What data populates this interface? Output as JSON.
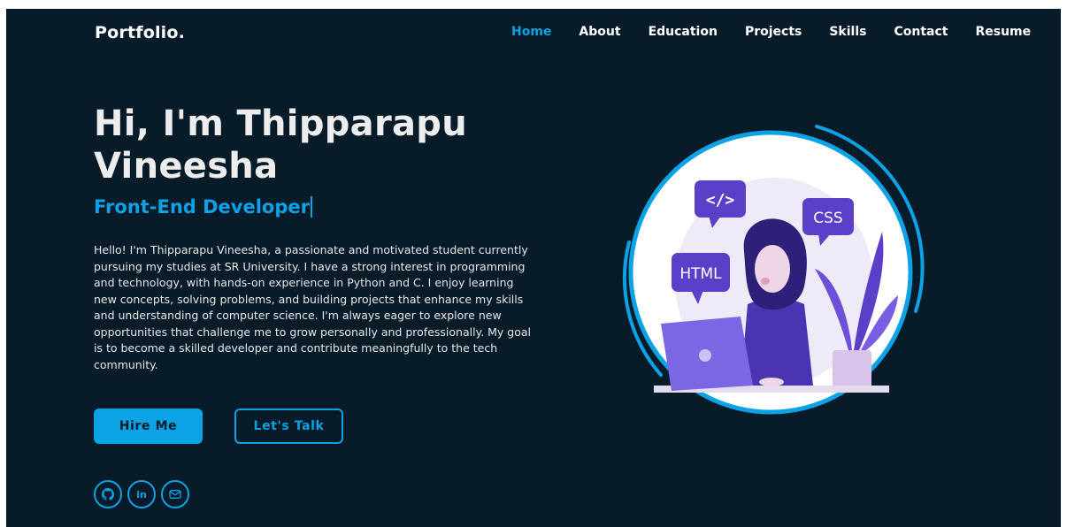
{
  "header": {
    "logo": "Portfolio.",
    "nav": [
      {
        "label": "Home",
        "active": true
      },
      {
        "label": "About"
      },
      {
        "label": "Education"
      },
      {
        "label": "Projects"
      },
      {
        "label": "Skills"
      },
      {
        "label": "Contact"
      },
      {
        "label": "Resume"
      }
    ]
  },
  "hero": {
    "title_line1": "Hi, I'm Thipparapu",
    "title_line2": "Vineesha",
    "role": "Front-End Developer",
    "description": "Hello! I'm Thipparapu Vineesha, a passionate and motivated student currently pursuing my studies at SR University. I have a strong interest in programming and technology, with hands-on experience in Python and C. I enjoy learning new concepts, solving problems, and building projects that enhance my skills and understanding of computer science. I'm always eager to explore new opportunities that challenge me to grow personally and professionally. My goal is to become a skilled developer and contribute meaningfully to the tech community.",
    "primary_button": "Hire Me",
    "secondary_button": "Let's Talk"
  },
  "social": {
    "linkedin_label": "in",
    "icons": [
      "github-icon",
      "linkedin-icon",
      "mail-icon"
    ]
  },
  "illustration": {
    "badges": [
      "</>",
      "CSS",
      "HTML"
    ]
  },
  "colors": {
    "background": "#081b29",
    "accent": "#0ba2e6",
    "text": "#ededed",
    "illustration_purple": "#5b3fc9"
  }
}
